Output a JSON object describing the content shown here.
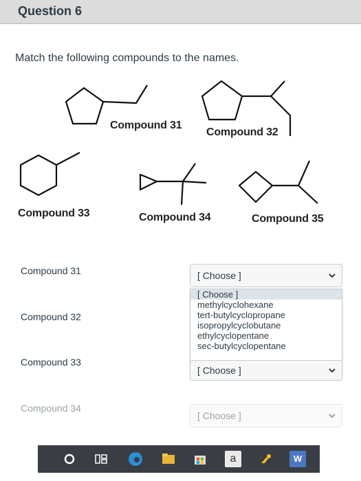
{
  "header": {
    "title": "Question 6"
  },
  "prompt": "Match the following compounds to the names.",
  "structures": [
    {
      "caption": "Compound 31"
    },
    {
      "caption": "Compound 32"
    },
    {
      "caption": "Compound 33"
    },
    {
      "caption": "Compound 34"
    },
    {
      "caption": "Compound 35"
    }
  ],
  "matches": [
    {
      "label": "Compound 31",
      "selected": "[ Choose ]"
    },
    {
      "label": "Compound 32",
      "selected": ""
    },
    {
      "label": "Compound 33",
      "selected": "[ Choose ]"
    },
    {
      "label": "Compound 34",
      "selected": "[ Choose ]"
    }
  ],
  "dropdown_options": [
    "[ Choose ]",
    "methylcyclohexane",
    "tert-butylcyclopropane",
    "isopropylcyclobutane",
    "ethylcyclopentane",
    "sec-butylcyclopentane"
  ],
  "taskbar": {
    "icons": [
      "circle-icon",
      "task-view-icon",
      "edge-icon",
      "file-explorer-icon",
      "store-icon",
      "amazon-icon",
      "steam-icon",
      "word-icon"
    ],
    "amazon_letter": "a",
    "word_letter": "W"
  }
}
